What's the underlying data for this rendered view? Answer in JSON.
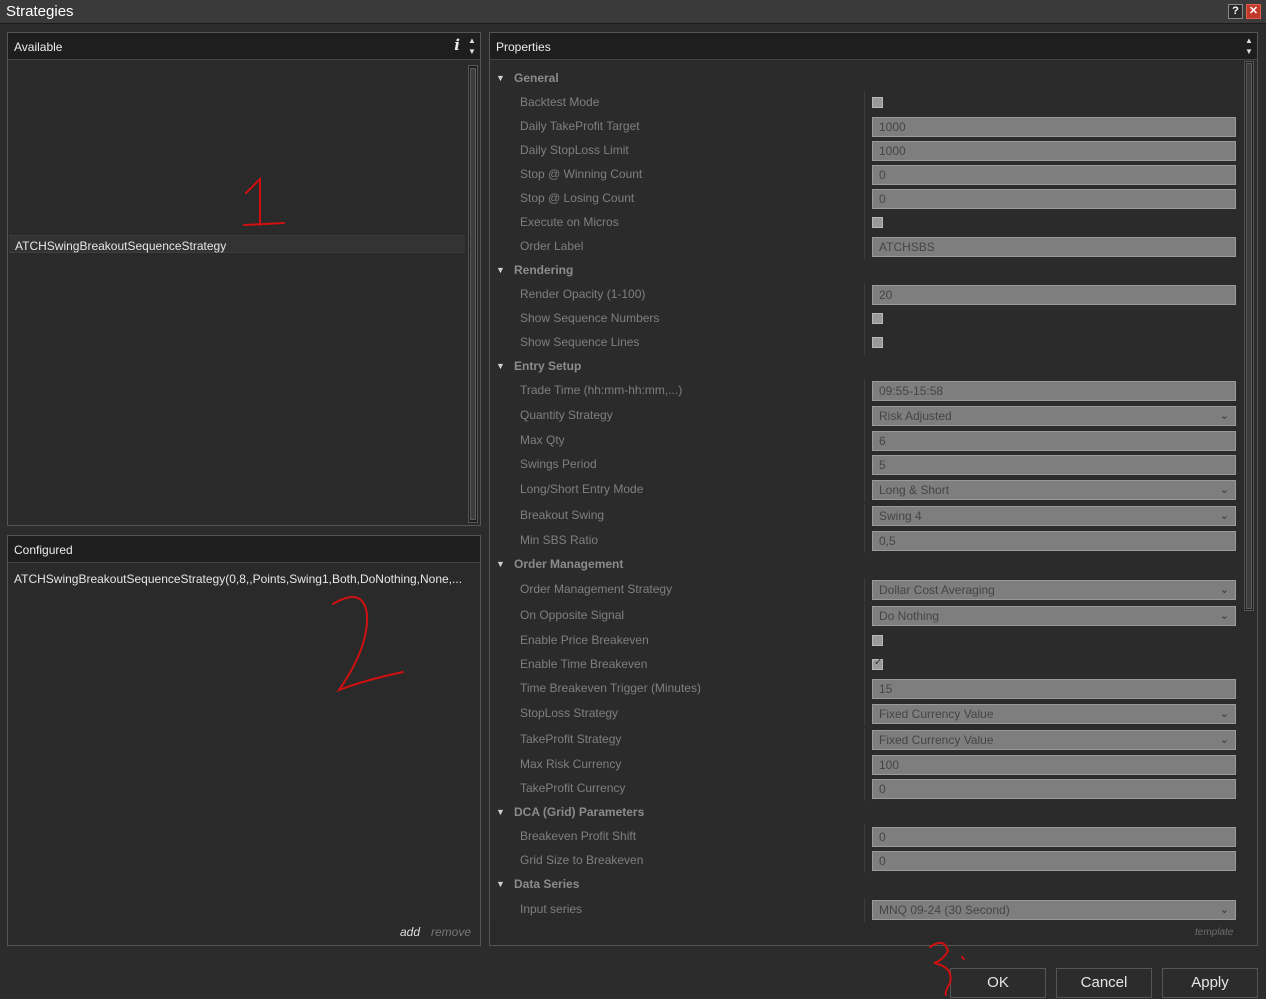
{
  "window": {
    "title": "Strategies",
    "help_label": "?",
    "close_label": "✕"
  },
  "available": {
    "header": "Available",
    "info_icon": "i",
    "spin_up": "▲",
    "spin_down": "▼",
    "items": [
      "ATCHSwingBreakoutSequenceStrategy"
    ]
  },
  "configured": {
    "header": "Configured",
    "items": [
      "ATCHSwingBreakoutSequenceStrategy(0,8,,Points,Swing1,Both,DoNothing,None,..."
    ],
    "add_label": "add",
    "remove_label": "remove"
  },
  "properties": {
    "header": "Properties",
    "template_label": "template",
    "rows": [
      {
        "kind": "cat",
        "name": "General"
      },
      {
        "kind": "chk",
        "name": "Backtest Mode",
        "checked": false
      },
      {
        "kind": "text",
        "name": "Daily TakeProfit Target",
        "value": "1000"
      },
      {
        "kind": "text",
        "name": "Daily StopLoss Limit",
        "value": "1000"
      },
      {
        "kind": "text",
        "name": "Stop @ Winning Count",
        "value": "0"
      },
      {
        "kind": "text",
        "name": "Stop @ Losing Count",
        "value": "0"
      },
      {
        "kind": "chk",
        "name": "Execute on Micros",
        "checked": false
      },
      {
        "kind": "text",
        "name": "Order Label",
        "value": "ATCHSBS"
      },
      {
        "kind": "cat",
        "name": "Rendering"
      },
      {
        "kind": "text",
        "name": "Render Opacity (1-100)",
        "value": "20"
      },
      {
        "kind": "chk",
        "name": "Show Sequence Numbers",
        "checked": false
      },
      {
        "kind": "chk",
        "name": "Show Sequence Lines",
        "checked": false
      },
      {
        "kind": "cat",
        "name": "Entry Setup"
      },
      {
        "kind": "text",
        "name": "Trade Time (hh:mm-hh:mm,...)",
        "value": "09:55-15:58"
      },
      {
        "kind": "select",
        "name": "Quantity Strategy",
        "value": "Risk Adjusted"
      },
      {
        "kind": "text",
        "name": "Max Qty",
        "value": "6"
      },
      {
        "kind": "text",
        "name": "Swings Period",
        "value": "5"
      },
      {
        "kind": "select",
        "name": "Long/Short Entry Mode",
        "value": "Long & Short"
      },
      {
        "kind": "select",
        "name": "Breakout Swing",
        "value": "Swing 4"
      },
      {
        "kind": "text",
        "name": "Min SBS Ratio",
        "value": "0,5"
      },
      {
        "kind": "cat",
        "name": "Order Management"
      },
      {
        "kind": "select",
        "name": "Order Management Strategy",
        "value": "Dollar Cost Averaging"
      },
      {
        "kind": "select",
        "name": "On Opposite Signal",
        "value": "Do Nothing"
      },
      {
        "kind": "chk",
        "name": "Enable Price Breakeven",
        "checked": false
      },
      {
        "kind": "chk",
        "name": "Enable Time Breakeven",
        "checked": true
      },
      {
        "kind": "text",
        "name": "Time Breakeven Trigger (Minutes)",
        "value": "15"
      },
      {
        "kind": "select",
        "name": "StopLoss Strategy",
        "value": "Fixed Currency Value"
      },
      {
        "kind": "select",
        "name": "TakeProfit Strategy",
        "value": "Fixed Currency Value"
      },
      {
        "kind": "text",
        "name": "Max Risk Currency",
        "value": "100"
      },
      {
        "kind": "text",
        "name": "TakeProfit Currency",
        "value": "0"
      },
      {
        "kind": "cat",
        "name": "DCA (Grid) Parameters"
      },
      {
        "kind": "text",
        "name": "Breakeven Profit Shift",
        "value": "0"
      },
      {
        "kind": "text",
        "name": "Grid Size to Breakeven",
        "value": "0"
      },
      {
        "kind": "cat",
        "name": "Data Series"
      },
      {
        "kind": "select",
        "name": "Input series",
        "value": "MNQ 09-24 (30 Second)"
      }
    ]
  },
  "buttons": {
    "ok": "OK",
    "cancel": "Cancel",
    "apply": "Apply"
  },
  "annotations": {
    "n1": "1",
    "n2": "2",
    "n3": "3"
  },
  "colors": {
    "annotation": "#d01010",
    "close_button": "#c0392b"
  }
}
